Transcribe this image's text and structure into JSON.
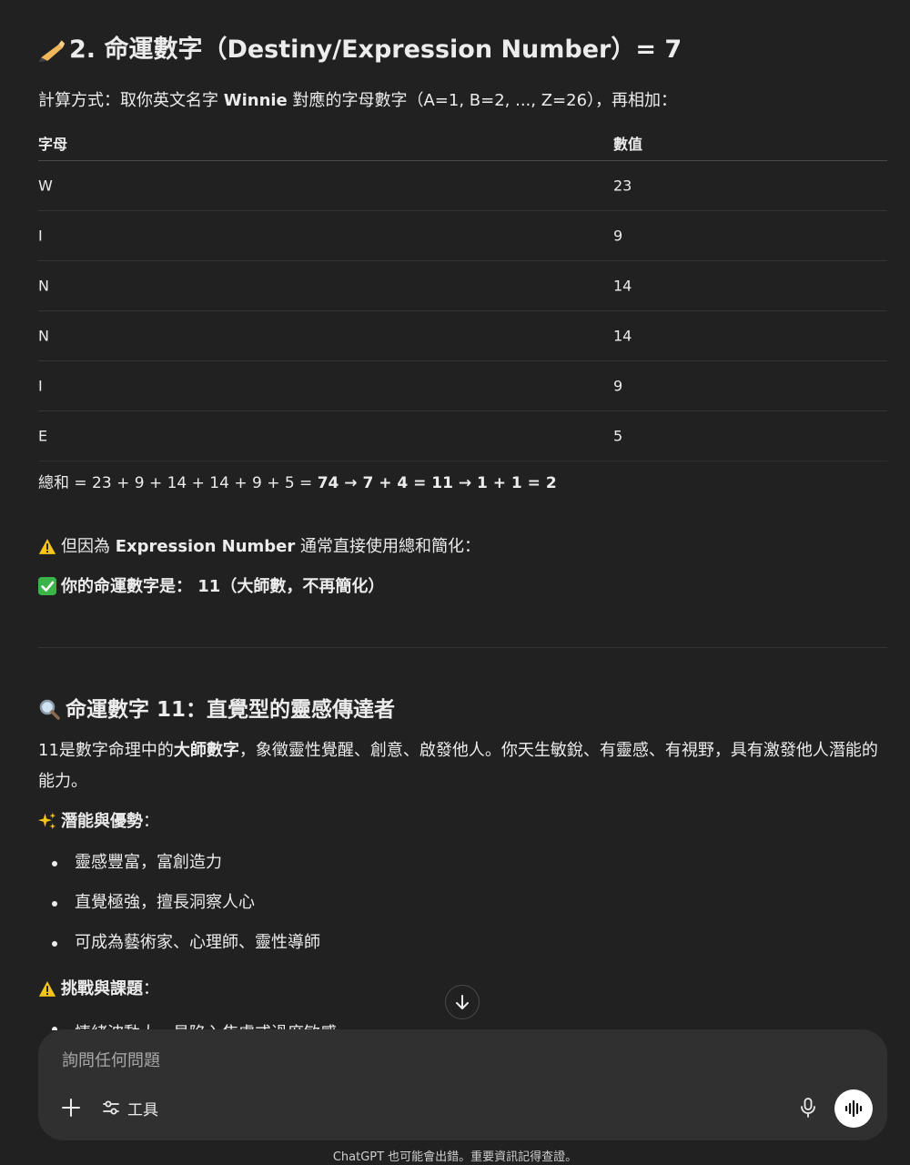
{
  "section1": {
    "heading": "2. 命運數字（Destiny/Expression Number）= 7",
    "method": {
      "prefix": "計算方式：取你英文名字 ",
      "name": "Winnie",
      "suffix": " 對應的字母數字（A=1, B=2, ..., Z=26），再相加："
    },
    "table": {
      "headers": [
        "字母",
        "數值"
      ],
      "rows": [
        [
          "W",
          "23"
        ],
        [
          "I",
          "9"
        ],
        [
          "N",
          "14"
        ],
        [
          "N",
          "14"
        ],
        [
          "I",
          "9"
        ],
        [
          "E",
          "5"
        ]
      ]
    },
    "sum": {
      "prefix": "總和 = 23 + 9 + 14 + 14 + 9 + 5 = ",
      "bold": "74 → 7 + 4 = 11 → 1 + 1 = 2"
    },
    "warning": {
      "prefix": "但因為 ",
      "bold": "Expression Number",
      "suffix": " 通常直接使用總和簡化："
    },
    "result": "你的命運數字是： 11（大師數，不再簡化）"
  },
  "section2": {
    "heading": "命運數字 11：直覺型的靈感傳達者",
    "intro": {
      "prefix": "11是數字命理中的",
      "bold": "大師數字",
      "suffix": "，象徵靈性覺醒、創意、啟發他人。你天生敏銳、有靈感、有視野，具有激發他人潛能的能力。"
    },
    "strengths_title": "潛能與優勢",
    "strengths_colon": "：",
    "strengths": [
      "靈感豐富，富創造力",
      "直覺極強，擅長洞察人心",
      "可成為藝術家、心理師、靈性導師"
    ],
    "challenges_title": "挑戰與課題",
    "challenges_colon": "：",
    "challenge_partial": "情緒波動大，易陷入焦慮或過度敏感"
  },
  "composer": {
    "placeholder": "詢問任何問題",
    "tools_label": "工具"
  },
  "footer": "ChatGPT 也可能會出錯。重要資訊記得查證。",
  "icons": {
    "heading1": "writing-hand-icon",
    "heading2": "magnifier-icon",
    "warning": "warning-icon",
    "check": "check-mark-icon",
    "sparkles": "sparkles-icon"
  }
}
